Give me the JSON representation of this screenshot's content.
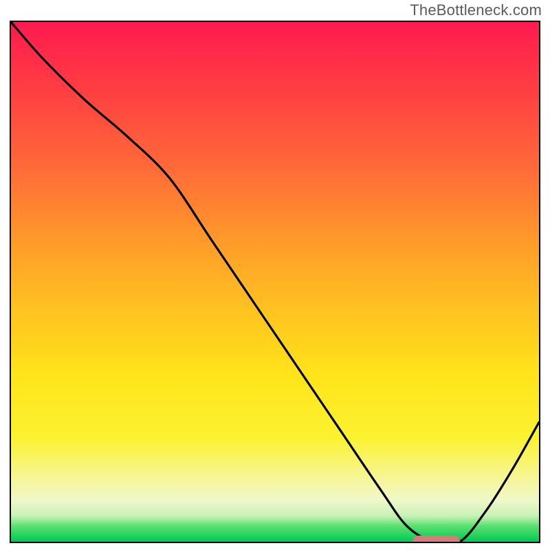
{
  "watermark": "TheBottleneck.com",
  "chart_data": {
    "type": "line",
    "title": "",
    "xlabel": "",
    "ylabel": "",
    "xlim": [
      0,
      100
    ],
    "ylim": [
      0,
      100
    ],
    "series": [
      {
        "name": "bottleneck-curve",
        "x": [
          0,
          6,
          14,
          22,
          30,
          38,
          46,
          54,
          62,
          70,
          75,
          80,
          85,
          90,
          95,
          100
        ],
        "y": [
          100,
          93,
          85,
          78,
          70,
          58,
          46,
          34,
          22,
          10,
          3,
          0,
          0,
          6,
          14,
          23
        ]
      }
    ],
    "marker": {
      "x_start": 76,
      "x_end": 85,
      "y": 0,
      "color": "#d67a7a"
    },
    "gradient_stops": [
      {
        "pos": 0,
        "color": "#ff1a4f"
      },
      {
        "pos": 28,
        "color": "#ff6a38"
      },
      {
        "pos": 55,
        "color": "#ffc120"
      },
      {
        "pos": 80,
        "color": "#fbf230"
      },
      {
        "pos": 100,
        "color": "#00c853"
      }
    ]
  }
}
